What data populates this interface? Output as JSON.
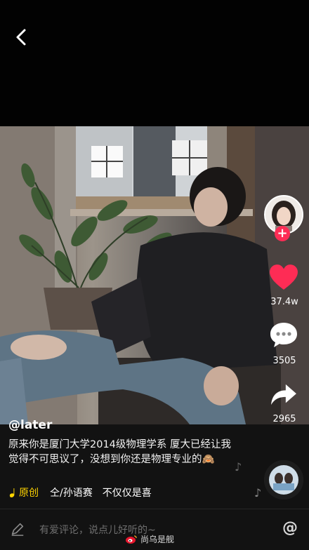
{
  "header": {
    "back_icon": "chevron-left-icon"
  },
  "post": {
    "handle": "@later",
    "description": "原来你是厦门大学2014级物理学系 厦大已经让我觉得不可思议了，没想到你还是物理专业的🙈",
    "music_badge": "原创",
    "music_text": "仝/孙语赛　不仅仅是喜"
  },
  "actions": {
    "likes": "37.4w",
    "comments": "3505",
    "shares": "2965",
    "like_color": "#fe2c55"
  },
  "comment_bar": {
    "placeholder": "有爱评论，说点儿好听的~",
    "at_label": "@"
  },
  "watermark": {
    "text": "尚乌是舰"
  }
}
